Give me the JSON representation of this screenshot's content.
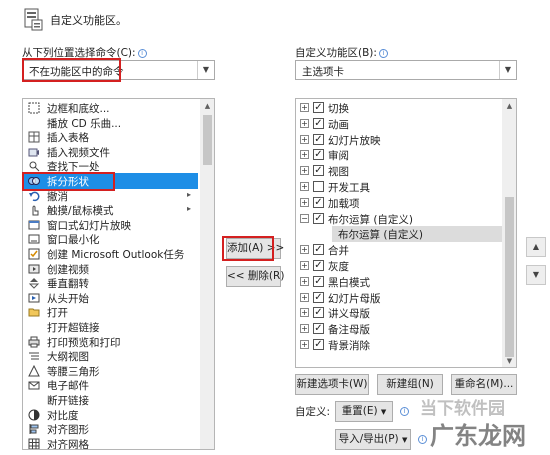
{
  "header": {
    "title": "自定义功能区。"
  },
  "left": {
    "label": "从下列位置选择命令(C):",
    "dropdown_value": "不在功能区中的命令",
    "items": [
      {
        "label": "边框和底纹...",
        "icon": "border-icon"
      },
      {
        "label": "播放 CD 乐曲...",
        "icon": "blank-icon"
      },
      {
        "label": "插入表格",
        "icon": "table-icon"
      },
      {
        "label": "插入视频文件",
        "icon": "video-icon"
      },
      {
        "label": "查找下一处",
        "icon": "find-icon"
      },
      {
        "label": "拆分形状",
        "icon": "split-shape-icon"
      },
      {
        "label": "撤消",
        "icon": "undo-icon"
      },
      {
        "label": "触摸/鼠标模式",
        "icon": "touch-icon"
      },
      {
        "label": "窗口式幻灯片放映",
        "icon": "window-icon"
      },
      {
        "label": "窗口最小化",
        "icon": "minimize-icon"
      },
      {
        "label": "创建 Microsoft Outlook任务",
        "icon": "outlook-icon"
      },
      {
        "label": "创建视频",
        "icon": "create-video-icon"
      },
      {
        "label": "垂直翻转",
        "icon": "flip-icon"
      },
      {
        "label": "从头开始",
        "icon": "start-icon"
      },
      {
        "label": "打开",
        "icon": "open-icon"
      },
      {
        "label": "打开超链接",
        "icon": "blank-icon"
      },
      {
        "label": "打印预览和打印",
        "icon": "print-icon"
      },
      {
        "label": "大纲视图",
        "icon": "outline-icon"
      },
      {
        "label": "等腰三角形",
        "icon": "triangle-icon"
      },
      {
        "label": "电子邮件",
        "icon": "email-icon"
      },
      {
        "label": "断开链接",
        "icon": "blank-icon"
      },
      {
        "label": "对比度",
        "icon": "contrast-icon"
      },
      {
        "label": "对齐图形",
        "icon": "align-icon"
      },
      {
        "label": "对齐网格",
        "icon": "grid-icon"
      }
    ]
  },
  "middle": {
    "add_button": "添加(A) >>",
    "remove_button": "<< 删除(R)"
  },
  "right": {
    "label": "自定义功能区(B):",
    "dropdown_value": "主选项卡",
    "items": [
      {
        "label": "切换",
        "checked": true,
        "expand": "+",
        "level": 0
      },
      {
        "label": "动画",
        "checked": true,
        "expand": "+",
        "level": 0
      },
      {
        "label": "幻灯片放映",
        "checked": true,
        "expand": "+",
        "level": 0
      },
      {
        "label": "审阅",
        "checked": true,
        "expand": "+",
        "level": 0
      },
      {
        "label": "视图",
        "checked": true,
        "expand": "+",
        "level": 0
      },
      {
        "label": "开发工具",
        "checked": false,
        "expand": "+",
        "level": 0
      },
      {
        "label": "加载项",
        "checked": true,
        "expand": "+",
        "level": 0
      },
      {
        "label": "布尔运算 (自定义)",
        "checked": true,
        "expand": "−",
        "level": 0
      },
      {
        "label": "布尔运算 (自定义)",
        "checked": null,
        "expand": "",
        "level": 1
      },
      {
        "label": "合并",
        "checked": true,
        "expand": "+",
        "level": 0
      },
      {
        "label": "灰度",
        "checked": true,
        "expand": "+",
        "level": 0
      },
      {
        "label": "黑白模式",
        "checked": true,
        "expand": "+",
        "level": 0
      },
      {
        "label": "幻灯片母版",
        "checked": true,
        "expand": "+",
        "level": 0
      },
      {
        "label": "讲义母版",
        "checked": true,
        "expand": "+",
        "level": 0
      },
      {
        "label": "备注母版",
        "checked": true,
        "expand": "+",
        "level": 0
      },
      {
        "label": "背景消除",
        "checked": true,
        "expand": "+",
        "level": 0
      }
    ],
    "new_tab_button": "新建选项卡(W)",
    "new_group_button": "新建组(N)",
    "rename_button": "重命名(M)...",
    "custom_label": "自定义:",
    "reset_button": "重置(E)",
    "import_export_button": "导入/导出(P)"
  },
  "watermark": {
    "line1": "当下软件园",
    "line2": "广东龙网"
  }
}
